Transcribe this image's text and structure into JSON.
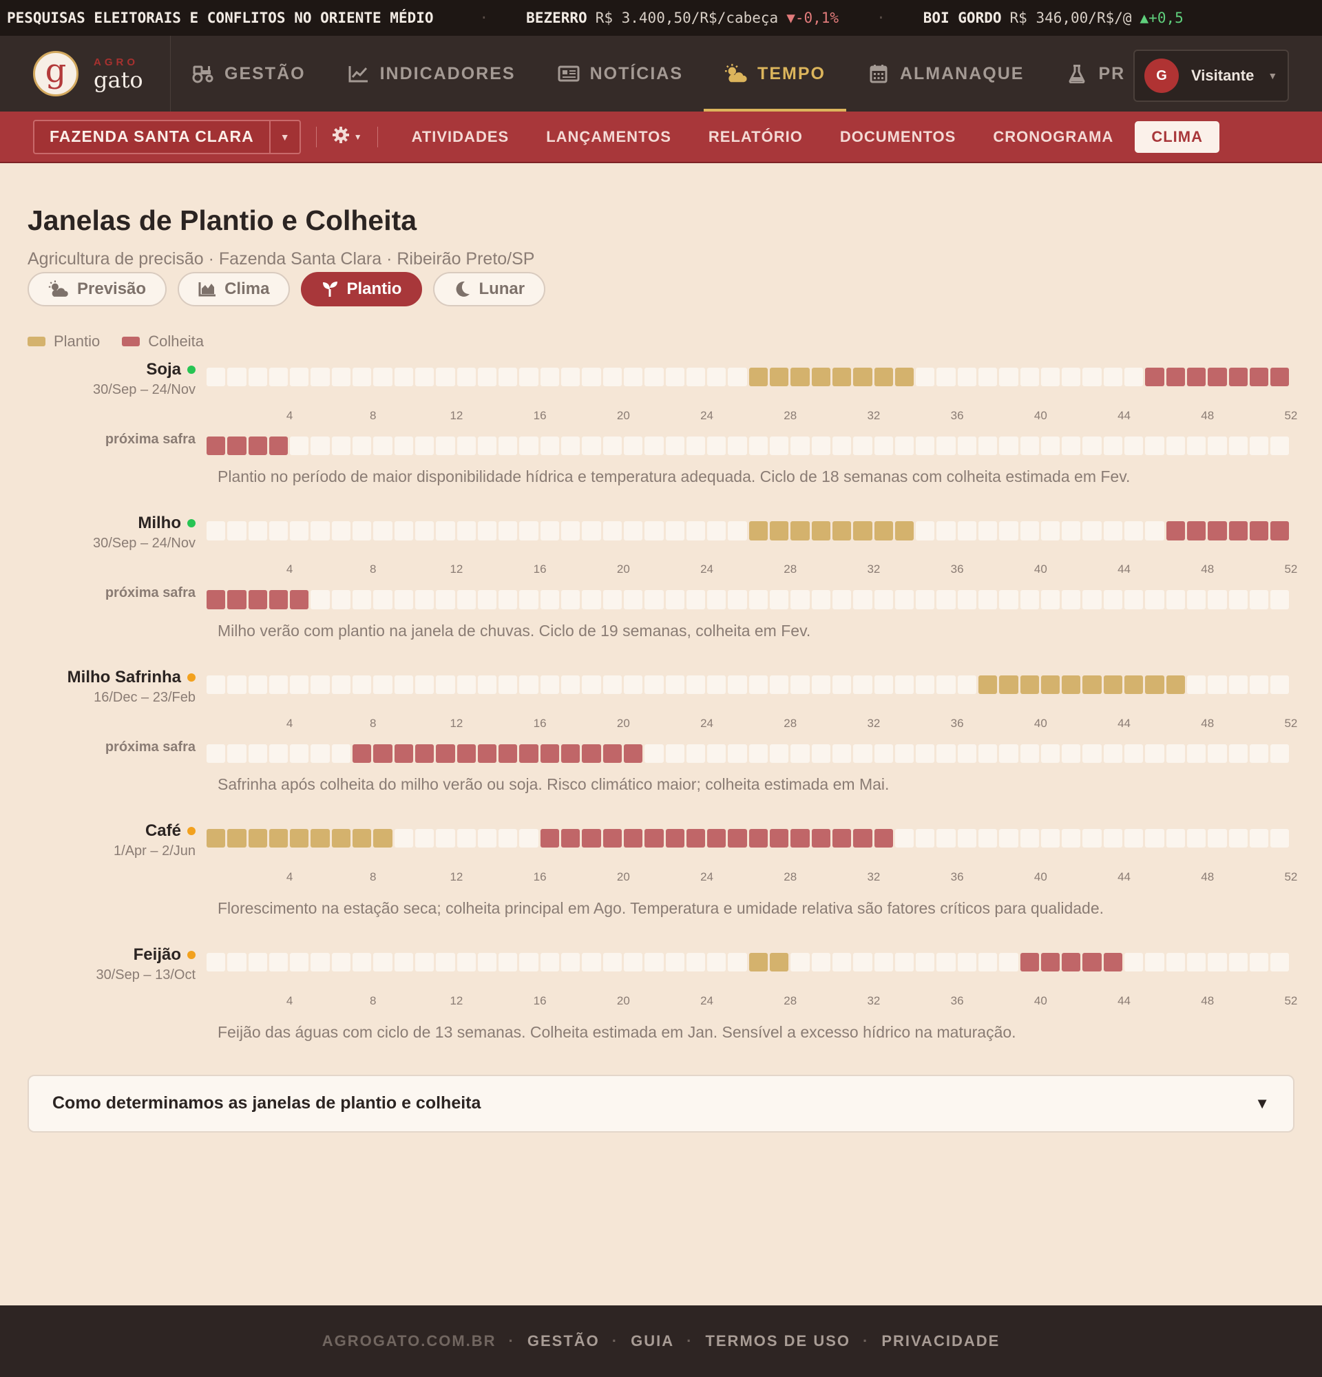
{
  "ticker": [
    {
      "name": "PESQUISAS ELEITORAIS E CONFLITOS NO ORIENTE MÉDIO",
      "value": "",
      "change": "",
      "direction": "none"
    },
    {
      "name": "BEZERRO",
      "value": "R$ 3.400,50/R$/cabeça",
      "change": "▼-0,1%",
      "direction": "down"
    },
    {
      "name": "BOI GORDO",
      "value": "R$ 346,00/R$/@",
      "change": "▲+0,5",
      "direction": "up"
    }
  ],
  "logo": {
    "letter": "g",
    "agro": "AGRO",
    "gato": "gato"
  },
  "nav": [
    {
      "label": "GESTÃO",
      "icon": "tractor-icon",
      "active": false
    },
    {
      "label": "INDICADORES",
      "icon": "chart-line-icon",
      "active": false
    },
    {
      "label": "NOTÍCIAS",
      "icon": "newspaper-icon",
      "active": false
    },
    {
      "label": "TEMPO",
      "icon": "sun-cloud-icon",
      "active": true
    },
    {
      "label": "ALMANAQUE",
      "icon": "calendar-icon",
      "active": false
    },
    {
      "label": "PR",
      "icon": "flask-icon",
      "active": false
    }
  ],
  "user": {
    "initial": "G",
    "name": "Visitante"
  },
  "subnav": {
    "farm": "FAZENDA SANTA CLARA",
    "items": [
      "ATIVIDADES",
      "LANÇAMENTOS",
      "RELATÓRIO",
      "DOCUMENTOS",
      "CRONOGRAMA",
      "CLIMA"
    ],
    "active": "CLIMA"
  },
  "page": {
    "title": "Janelas de Plantio e Colheita",
    "subtitle": "Agricultura de precisão · Fazenda Santa Clara · Ribeirão Preto/SP"
  },
  "tabs": [
    {
      "label": "Previsão",
      "icon": "sun-cloud-icon",
      "active": false
    },
    {
      "label": "Clima",
      "icon": "area-chart-icon",
      "active": false
    },
    {
      "label": "Plantio",
      "icon": "seedling-icon",
      "active": true
    },
    {
      "label": "Lunar",
      "icon": "moon-icon",
      "active": false
    }
  ],
  "legend": [
    {
      "label": "Plantio",
      "color": "#d4b26d"
    },
    {
      "label": "Colheita",
      "color": "#c06668"
    }
  ],
  "colors": {
    "plant": "#d4b26d",
    "harvest": "#c06668",
    "empty": "#fbf5ee",
    "dot_green": "#27c453",
    "dot_orange": "#f2a11e"
  },
  "weeks_total": 52,
  "week_ticks": [
    "4",
    "8",
    "12",
    "16",
    "20",
    "24",
    "28",
    "32",
    "36",
    "40",
    "44",
    "48",
    "52"
  ],
  "next_label": "próxima safra",
  "crops": [
    {
      "name": "Soja",
      "dot": "green",
      "dates": "30/Sep – 24/Nov",
      "plant_weeks": [
        27,
        34
      ],
      "harvest_weeks": [
        46,
        52
      ],
      "next_harvest_weeks": [
        1,
        4
      ],
      "note": "Plantio no período de maior disponibilidade hídrica e temperatura adequada. Ciclo de 18 semanas com colheita estimada em Fev."
    },
    {
      "name": "Milho",
      "dot": "green",
      "dates": "30/Sep – 24/Nov",
      "plant_weeks": [
        27,
        34
      ],
      "harvest_weeks": [
        47,
        52
      ],
      "next_harvest_weeks": [
        1,
        5
      ],
      "note": "Milho verão com plantio na janela de chuvas. Ciclo de 19 semanas, colheita em Fev."
    },
    {
      "name": "Milho Safrinha",
      "dot": "orange",
      "dates": "16/Dec – 23/Feb",
      "plant_weeks": [
        38,
        47
      ],
      "harvest_weeks": [],
      "next_harvest_weeks": [
        8,
        21
      ],
      "note": "Safrinha após colheita do milho verão ou soja. Risco climático maior; colheita estimada em Mai."
    },
    {
      "name": "Café",
      "dot": "orange",
      "dates": "1/Apr – 2/Jun",
      "plant_weeks": [
        1,
        9
      ],
      "harvest_weeks": [
        17,
        33
      ],
      "next_harvest_weeks": null,
      "note": "Florescimento na estação seca; colheita principal em Ago. Temperatura e umidade relativa são fatores críticos para qualidade."
    },
    {
      "name": "Feijão",
      "dot": "orange",
      "dates": "30/Sep – 13/Oct",
      "plant_weeks": [
        27,
        28
      ],
      "harvest_weeks": [
        40,
        44
      ],
      "next_harvest_weeks": null,
      "note": "Feijão das águas com ciclo de 13 semanas. Colheita estimada em Jan. Sensível a excesso hídrico na maturação."
    }
  ],
  "explain": {
    "title": "Como determinamos as janelas de plantio e colheita",
    "caret": "▼"
  },
  "footer": [
    "AGROGATO.COM.BR",
    "GESTÃO",
    "GUIA",
    "TERMOS DE USO",
    "PRIVACIDADE"
  ]
}
